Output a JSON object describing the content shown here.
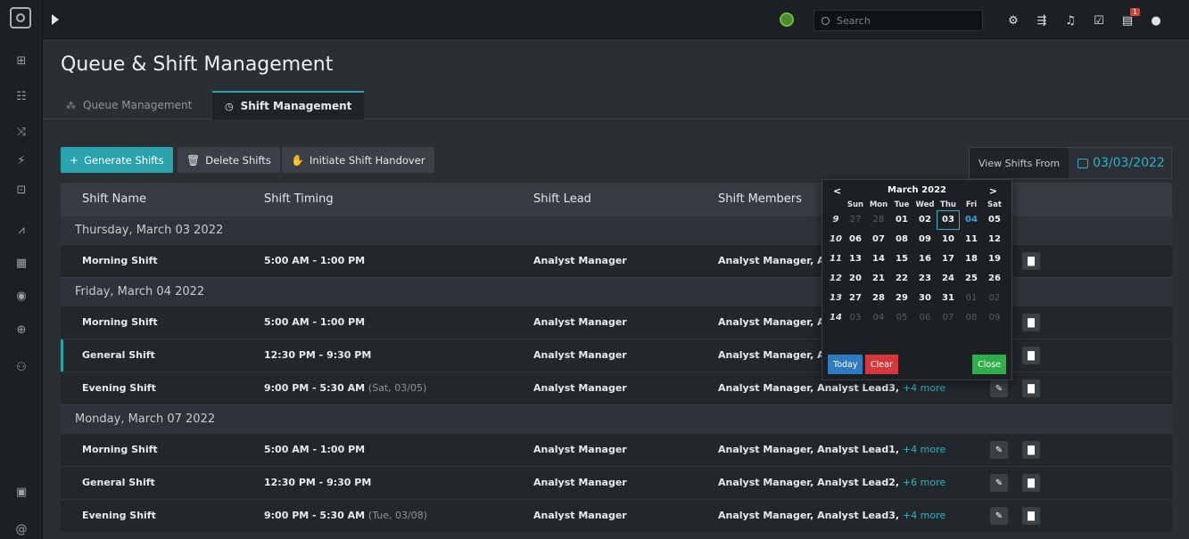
{
  "topbar": {
    "search_placeholder": "Search",
    "notification_count": "1"
  },
  "page": {
    "title": "Queue & Shift Management",
    "tabs": [
      {
        "label": "Queue Management",
        "icon": "queue-icon",
        "active": false
      },
      {
        "label": "Shift Management",
        "icon": "clock-icon",
        "active": true
      }
    ]
  },
  "actions": {
    "generate": "Generate Shifts",
    "delete": "Delete Shifts",
    "handover": "Initiate Shift Handover"
  },
  "view_from": {
    "label": "View Shifts From",
    "date": "03/03/2022"
  },
  "table": {
    "headers": [
      "Shift Name",
      "Shift Timing",
      "Shift Lead",
      "Shift Members"
    ],
    "groups": [
      {
        "date": "Thursday, March 03 2022",
        "rows": [
          {
            "name": "Morning Shift",
            "timing": "5:00 AM - 1:00 PM",
            "timing_note": "",
            "lead": "Analyst Manager",
            "members": "Analyst Manager, Ana",
            "more": ""
          }
        ]
      },
      {
        "date": "Friday, March 04 2022",
        "rows": [
          {
            "name": "Morning Shift",
            "timing": "5:00 AM - 1:00 PM",
            "timing_note": "",
            "lead": "Analyst Manager",
            "members": "Analyst Manager, Ana",
            "more": ""
          },
          {
            "name": "General Shift",
            "timing": "12:30 PM - 9:30 PM",
            "timing_note": "",
            "lead": "Analyst Manager",
            "members": "Analyst Manager, Ana",
            "more": ""
          },
          {
            "name": "Evening Shift",
            "timing": "9:00 PM - 5:30 AM",
            "timing_note": "(Sat, 03/05)",
            "lead": "Analyst Manager",
            "members": "Analyst Manager, Analyst Lead3,",
            "more": "+4 more"
          }
        ]
      },
      {
        "date": "Monday, March 07 2022",
        "rows": [
          {
            "name": "Morning Shift",
            "timing": "5:00 AM - 1:00 PM",
            "timing_note": "",
            "lead": "Analyst Manager",
            "members": "Analyst Manager, Analyst Lead1,",
            "more": "+4 more"
          },
          {
            "name": "General Shift",
            "timing": "12:30 PM - 9:30 PM",
            "timing_note": "",
            "lead": "Analyst Manager",
            "members": "Analyst Manager, Analyst Lead2,",
            "more": "+6 more"
          },
          {
            "name": "Evening Shift",
            "timing": "9:00 PM - 5:30 AM",
            "timing_note": "(Tue, 03/08)",
            "lead": "Analyst Manager",
            "members": "Analyst Manager, Analyst Lead3,",
            "more": "+4 more"
          }
        ]
      }
    ]
  },
  "datepicker": {
    "month": "March 2022",
    "prev": "<",
    "next": ">",
    "dow": [
      "Sun",
      "Mon",
      "Tue",
      "Wed",
      "Thu",
      "Fri",
      "Sat"
    ],
    "weeks": [
      {
        "wk": "9",
        "days": [
          [
            "27",
            "off"
          ],
          [
            "28",
            "off"
          ],
          [
            "01",
            ""
          ],
          [
            "02",
            ""
          ],
          [
            "03",
            "today"
          ],
          [
            "04",
            "sel"
          ],
          [
            "05",
            ""
          ]
        ]
      },
      {
        "wk": "10",
        "days": [
          [
            "06",
            ""
          ],
          [
            "07",
            ""
          ],
          [
            "08",
            ""
          ],
          [
            "09",
            ""
          ],
          [
            "10",
            ""
          ],
          [
            "11",
            ""
          ],
          [
            "12",
            ""
          ]
        ]
      },
      {
        "wk": "11",
        "days": [
          [
            "13",
            ""
          ],
          [
            "14",
            ""
          ],
          [
            "15",
            ""
          ],
          [
            "16",
            ""
          ],
          [
            "17",
            ""
          ],
          [
            "18",
            ""
          ],
          [
            "19",
            ""
          ]
        ]
      },
      {
        "wk": "12",
        "days": [
          [
            "20",
            ""
          ],
          [
            "21",
            ""
          ],
          [
            "22",
            ""
          ],
          [
            "23",
            ""
          ],
          [
            "24",
            ""
          ],
          [
            "25",
            ""
          ],
          [
            "26",
            ""
          ]
        ]
      },
      {
        "wk": "13",
        "days": [
          [
            "27",
            ""
          ],
          [
            "28",
            ""
          ],
          [
            "29",
            ""
          ],
          [
            "30",
            ""
          ],
          [
            "31",
            ""
          ],
          [
            "01",
            "off"
          ],
          [
            "02",
            "off"
          ]
        ]
      },
      {
        "wk": "14",
        "days": [
          [
            "03",
            "off"
          ],
          [
            "04",
            "off"
          ],
          [
            "05",
            "off"
          ],
          [
            "06",
            "off"
          ],
          [
            "07",
            "off"
          ],
          [
            "08",
            "off"
          ],
          [
            "09",
            "off"
          ]
        ]
      }
    ],
    "today_btn": "Today",
    "clear_btn": "Clear",
    "close_btn": "Close"
  }
}
